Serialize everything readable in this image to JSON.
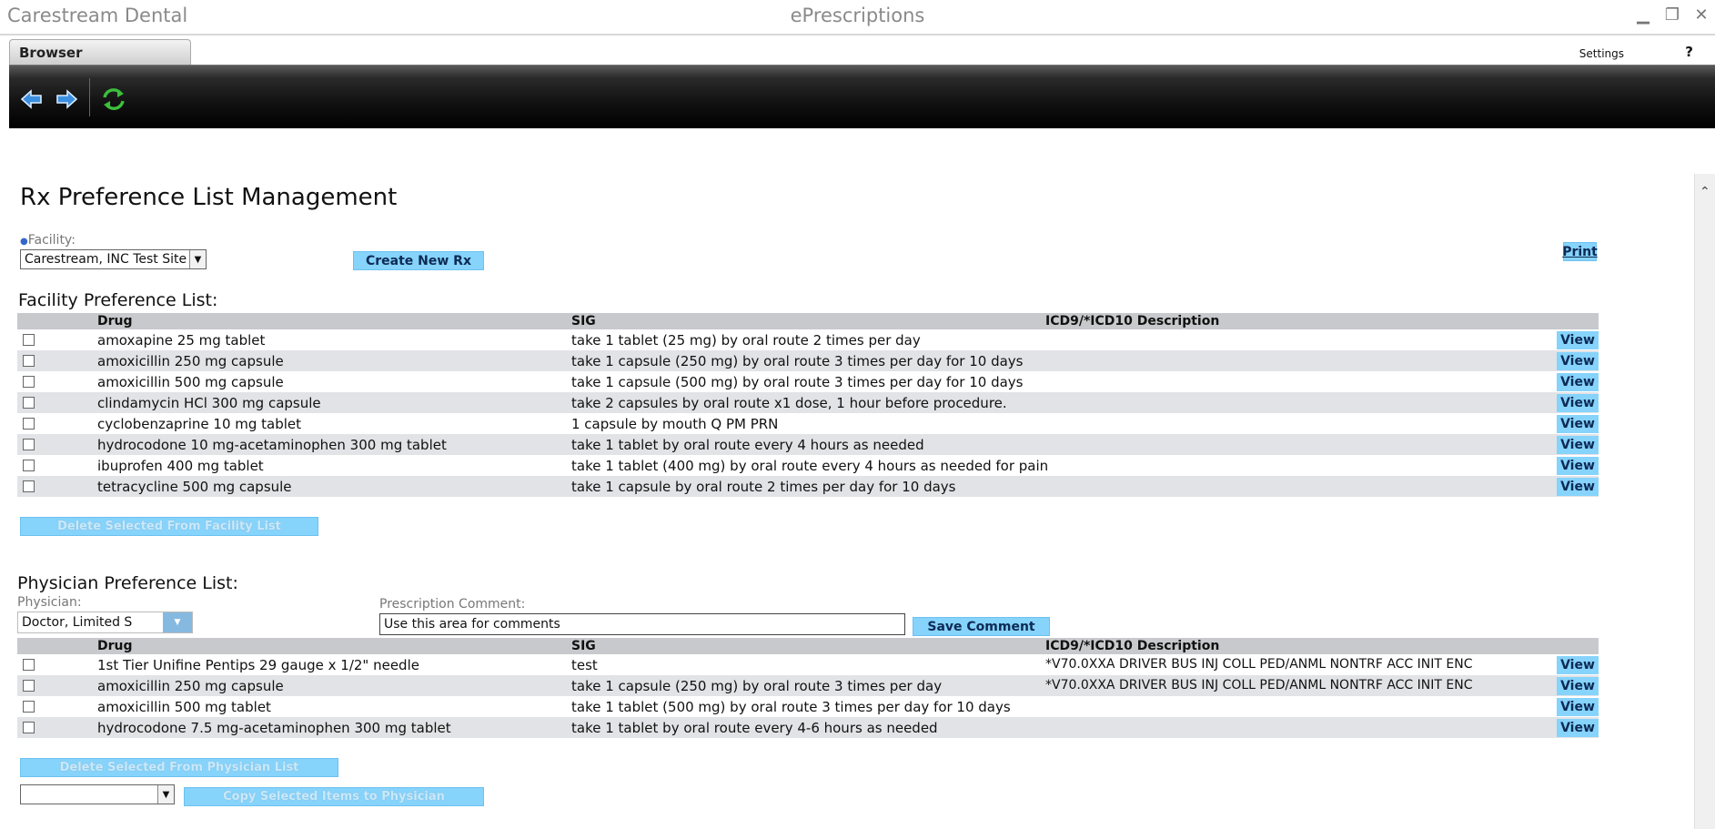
{
  "window": {
    "app_name": "Carestream Dental",
    "title": "ePrescriptions",
    "controls": [
      "minimize-icon",
      "restore-icon",
      "close-icon"
    ]
  },
  "tabs": {
    "browser": "Browser"
  },
  "header_links": {
    "settings": "Settings",
    "help": "?"
  },
  "toolbar": {
    "icons": [
      "back-arrow-icon",
      "forward-arrow-icon",
      "refresh-icon"
    ]
  },
  "page": {
    "title": "Rx Preference List Management",
    "facility_label": "Facility:",
    "facility_value": "Carestream, INC Test Site",
    "create_new_rx": "Create New Rx",
    "print": "Print"
  },
  "facility_list": {
    "title": "Facility Preference List:",
    "columns": {
      "drug": "Drug",
      "sig": "SIG",
      "icd": "ICD9/*ICD10 Description"
    },
    "rows": [
      {
        "drug": "amoxapine 25 mg tablet",
        "sig": "take 1 tablet (25 mg) by oral route 2 times per day",
        "icd": "",
        "action": "View"
      },
      {
        "drug": "amoxicillin 250 mg capsule",
        "sig": "take 1 capsule (250 mg) by oral route 3 times per day for 10 days",
        "icd": "",
        "action": "View"
      },
      {
        "drug": "amoxicillin 500 mg capsule",
        "sig": "take 1 capsule (500 mg) by oral route 3 times per day for 10 days",
        "icd": "",
        "action": "View"
      },
      {
        "drug": "clindamycin HCl 300 mg capsule",
        "sig": "take 2 capsules by oral route x1 dose, 1 hour before procedure.",
        "icd": "",
        "action": "View"
      },
      {
        "drug": "cyclobenzaprine 10 mg tablet",
        "sig": "1 capsule by mouth Q PM PRN",
        "icd": "",
        "action": "View"
      },
      {
        "drug": "hydrocodone 10 mg-acetaminophen 300 mg tablet",
        "sig": "take 1 tablet by oral route every 4 hours as needed",
        "icd": "",
        "action": "View"
      },
      {
        "drug": "ibuprofen 400 mg tablet",
        "sig": "take 1 tablet (400 mg) by oral route every 4 hours as needed for pain",
        "icd": "",
        "action": "View"
      },
      {
        "drug": "tetracycline 500 mg capsule",
        "sig": "take 1 capsule by oral route 2 times per day for 10 days",
        "icd": "",
        "action": "View"
      }
    ],
    "delete_button": "Delete Selected From Facility List"
  },
  "physician_list": {
    "title": "Physician Preference List:",
    "physician_label": "Physician:",
    "physician_value": "Doctor, Limited S",
    "comment_label": "Prescription Comment:",
    "comment_value": "Use this area for comments",
    "save_comment": "Save Comment",
    "columns": {
      "drug": "Drug",
      "sig": "SIG",
      "icd": "ICD9/*ICD10 Description"
    },
    "rows": [
      {
        "drug": "1st Tier Unifine Pentips 29 gauge x 1/2\" needle",
        "sig": "test",
        "icd": "*V70.0XXA DRIVER BUS INJ COLL PED/ANML NONTRF ACC INIT ENC",
        "action": "View"
      },
      {
        "drug": "amoxicillin 250 mg capsule",
        "sig": "take 1 capsule (250 mg) by oral route 3 times per day",
        "icd": "*V70.0XXA DRIVER BUS INJ COLL PED/ANML NONTRF ACC INIT ENC",
        "action": "View"
      },
      {
        "drug": "amoxicillin 500 mg tablet",
        "sig": "take 1 tablet (500 mg) by oral route 3 times per day for 10 days",
        "icd": "",
        "action": "View"
      },
      {
        "drug": "hydrocodone 7.5 mg-acetaminophen 300 mg tablet",
        "sig": "take 1 tablet by oral route every 4-6 hours as needed",
        "icd": "",
        "action": "View"
      }
    ],
    "delete_button": "Delete Selected From Physician List",
    "copy_target_value": "",
    "copy_button": "Copy Selected Items to Physician"
  }
}
